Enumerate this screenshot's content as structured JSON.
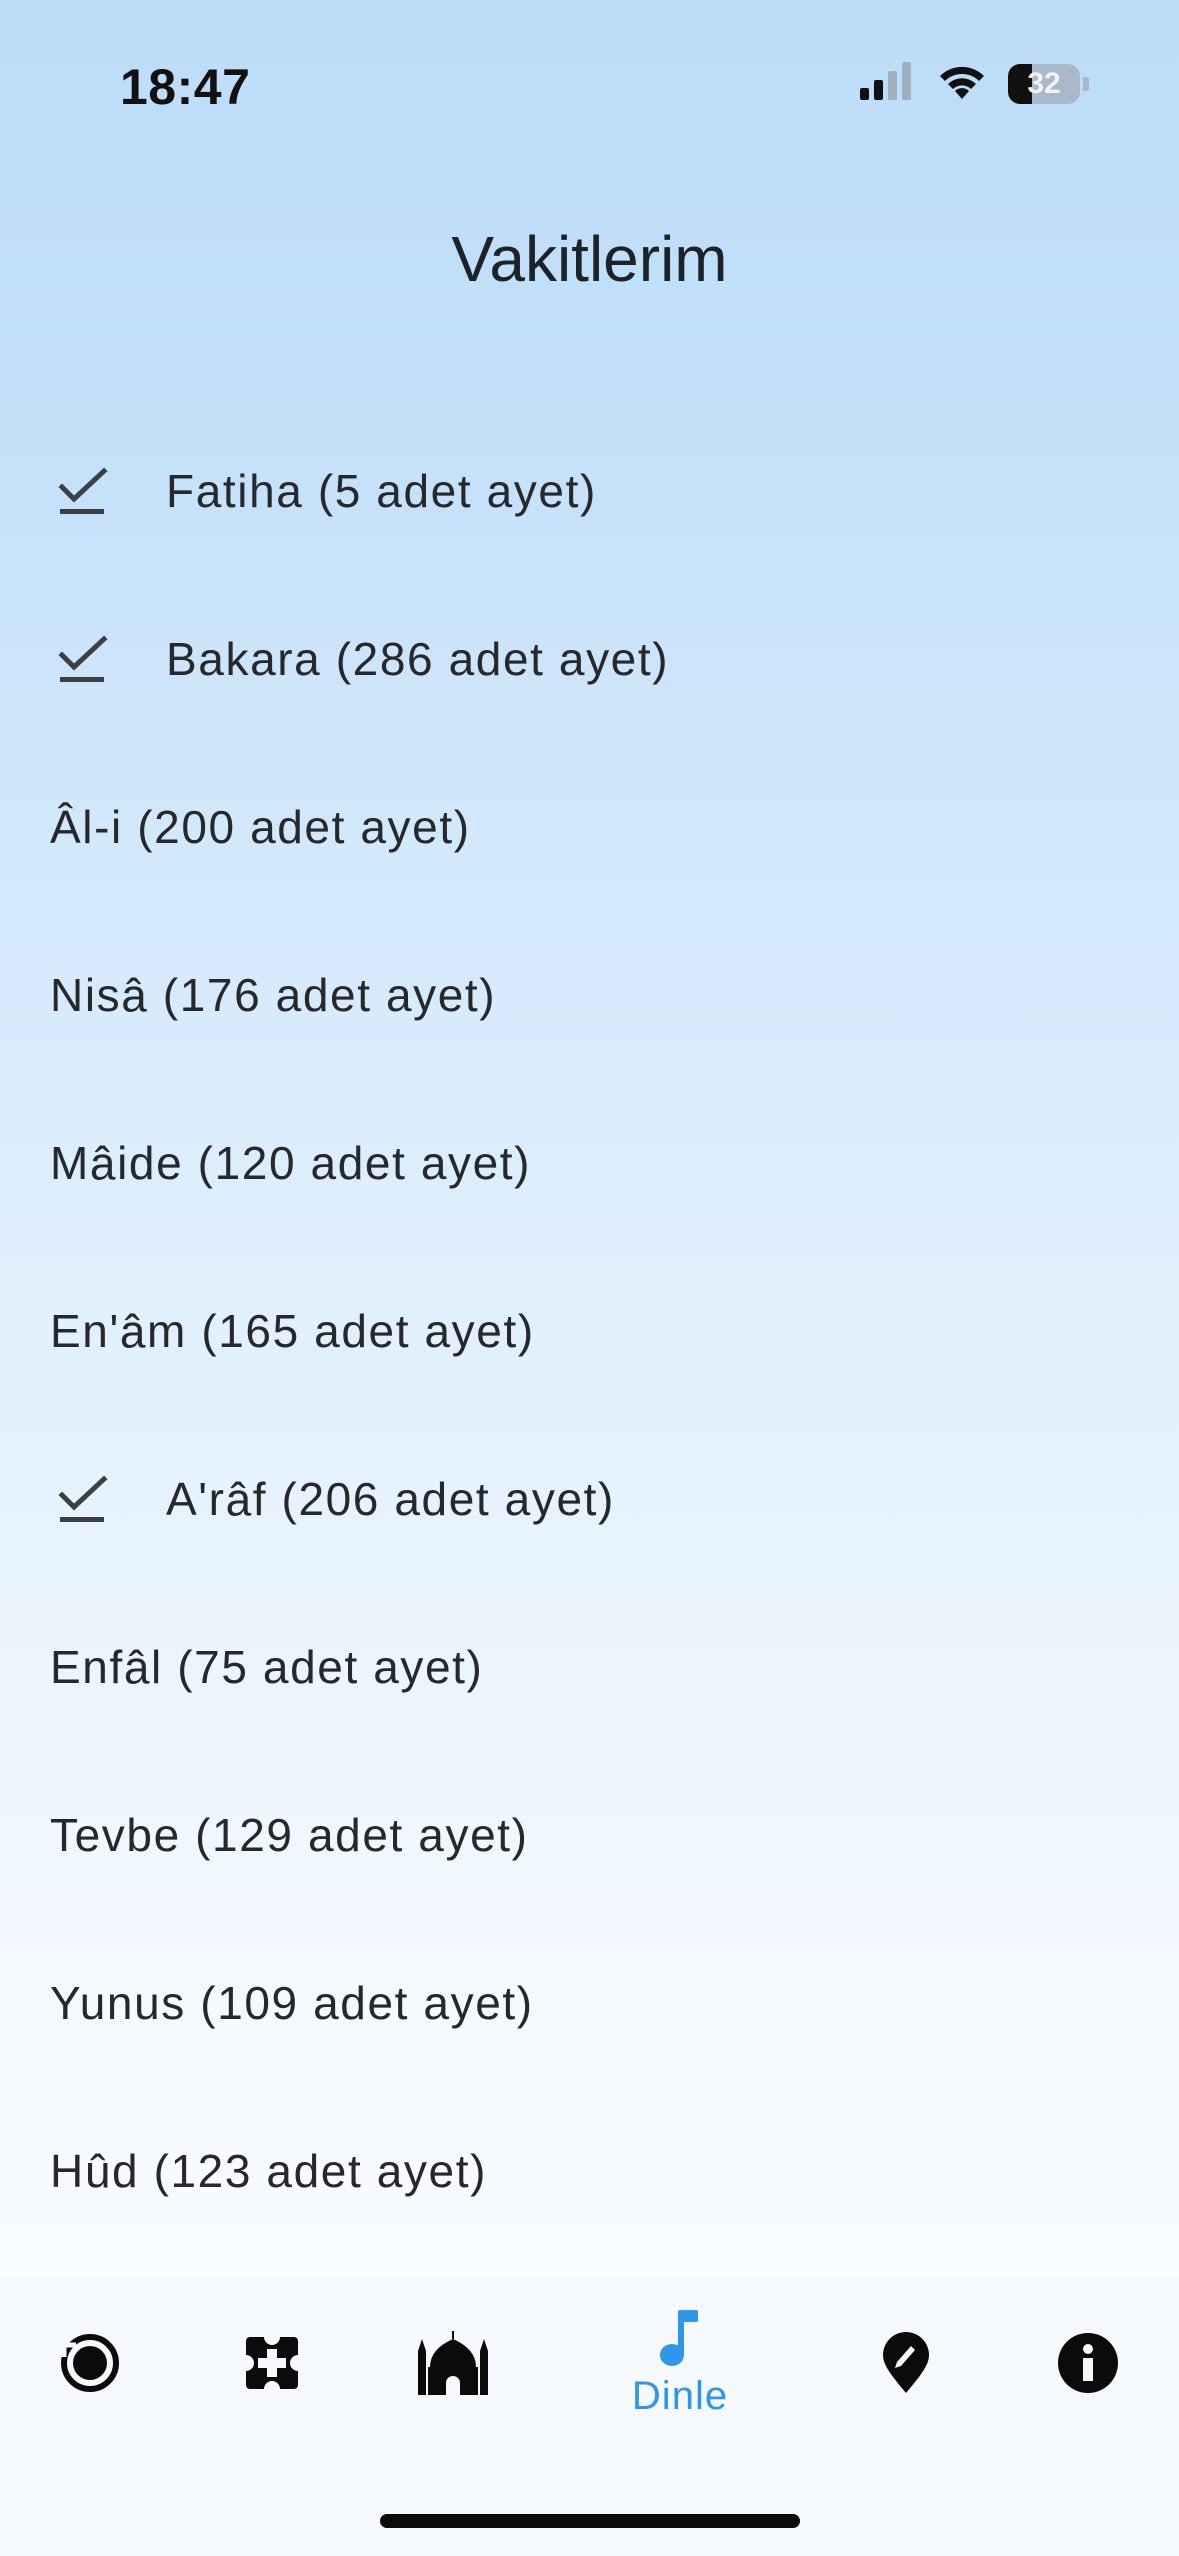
{
  "status_bar": {
    "time": "18:47",
    "battery": "32"
  },
  "header": {
    "title": "Vakitlerim"
  },
  "surahs": [
    {
      "label": "Fatiha (5 adet ayet)",
      "checked": true
    },
    {
      "label": "Bakara (286 adet ayet)",
      "checked": true
    },
    {
      "label": "Âl-i (200 adet ayet)",
      "checked": false
    },
    {
      "label": "Nisâ (176 adet ayet)",
      "checked": false
    },
    {
      "label": "Mâide (120 adet ayet)",
      "checked": false
    },
    {
      "label": "En'âm (165 adet ayet)",
      "checked": false
    },
    {
      "label": "A'râf (206 adet ayet)",
      "checked": true
    },
    {
      "label": "Enfâl (75 adet ayet)",
      "checked": false
    },
    {
      "label": "Tevbe (129 adet ayet)",
      "checked": false
    },
    {
      "label": "Yunus (109 adet ayet)",
      "checked": false
    },
    {
      "label": "Hûd (123 adet ayet)",
      "checked": false
    }
  ],
  "bottom_nav": {
    "items": [
      {
        "icon": "target-circle-icon"
      },
      {
        "icon": "counter-icon"
      },
      {
        "icon": "mosque-icon"
      },
      {
        "icon": "music-note-icon",
        "label": "Dinle",
        "active": true
      },
      {
        "icon": "compass-pin-icon"
      },
      {
        "icon": "info-icon"
      }
    ]
  },
  "colors": {
    "active": "#2e97ea",
    "icon": "#0b0b0b",
    "text": "#26282c"
  }
}
